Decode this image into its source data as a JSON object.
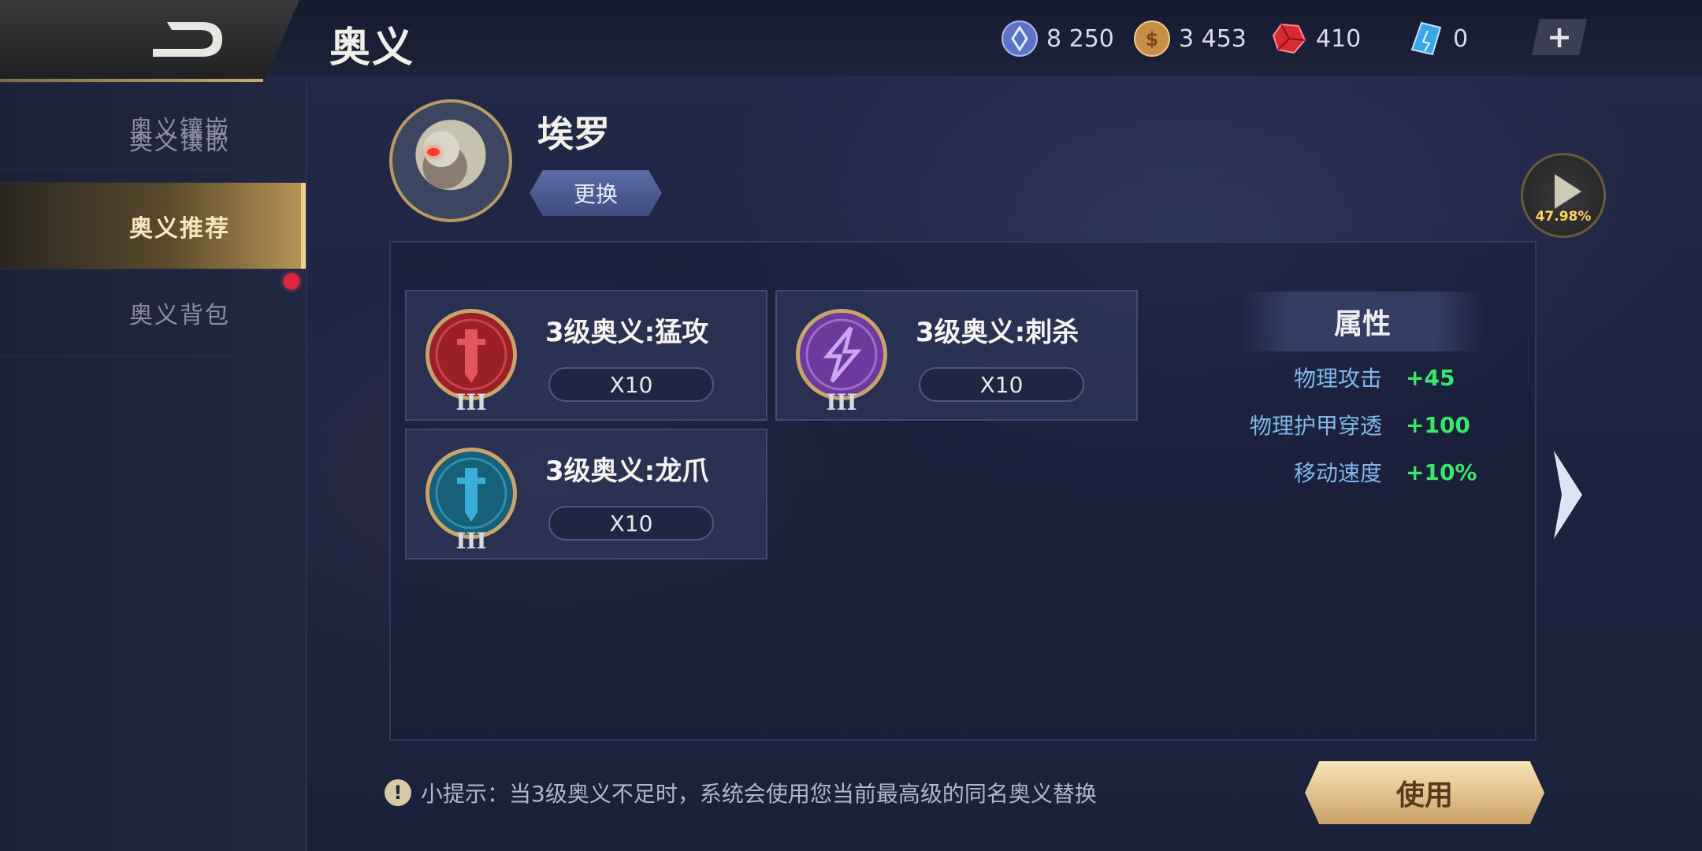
{
  "header": {
    "title": "奥义",
    "currencies": [
      {
        "icon": "diamond-coin-icon",
        "value": "8 250"
      },
      {
        "icon": "gold-coin-icon",
        "value": "3 453"
      },
      {
        "icon": "red-gem-icon",
        "value": "410"
      },
      {
        "icon": "blue-crystal-icon",
        "value": "0"
      }
    ],
    "plus_label": "+"
  },
  "sidebar": {
    "items": [
      {
        "label": "奥义镶嵌",
        "active": false
      },
      {
        "label": "奥义推荐",
        "active": true
      },
      {
        "label": "奥义背包",
        "active": false
      }
    ]
  },
  "hero": {
    "name": "埃罗",
    "change_label": "更换",
    "play_percent": "47.98%"
  },
  "cards": [
    {
      "title": "3级奥义:猛攻",
      "qty": "X10",
      "tier": "III",
      "color": "#9b1f28"
    },
    {
      "title": "3级奥义:刺杀",
      "qty": "X10",
      "tier": "III",
      "color": "#6b3a9c"
    },
    {
      "title": "3级奥义:龙爪",
      "qty": "X10",
      "tier": "III",
      "color": "#176079"
    }
  ],
  "attributes": {
    "title": "属性",
    "rows": [
      {
        "name": "物理攻击",
        "value": "+45"
      },
      {
        "name": "物理护甲穿透",
        "value": "+100"
      },
      {
        "name": "移动速度",
        "value": "+10%"
      }
    ]
  },
  "footer": {
    "tip_icon": "!",
    "tip": "小提示：当3级奥义不足时，系统会使用您当前最高级的同名奥义替换",
    "use_label": "使用"
  }
}
